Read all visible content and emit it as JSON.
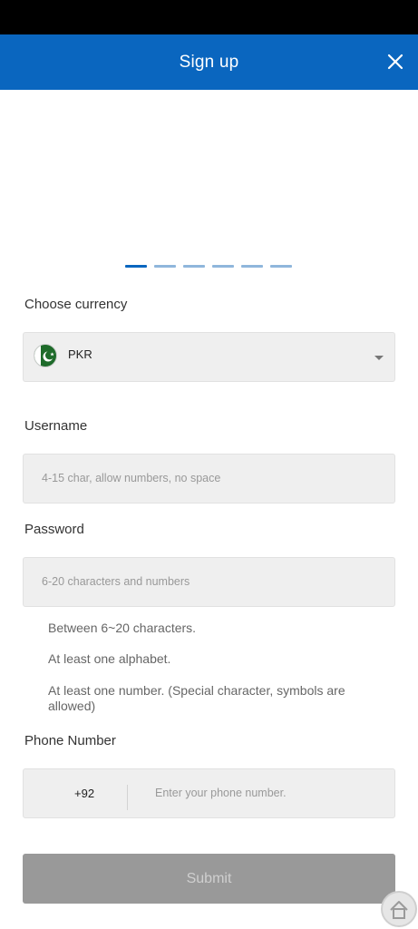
{
  "header": {
    "title": "Sign up",
    "close_icon": "close-icon"
  },
  "carousel": {
    "dot_count": 6,
    "active_index": 0
  },
  "currency": {
    "label": "Choose currency",
    "selected": "PKR",
    "flag_icon": "pakistan-flag-icon"
  },
  "username": {
    "label": "Username",
    "placeholder": "4-15 char, allow numbers, no space"
  },
  "password": {
    "label": "Password",
    "placeholder": "6-20 characters and numbers",
    "rules": [
      "Between 6~20 characters.",
      "At least one alphabet.",
      "At least one number. (Special character, symbols are allowed)"
    ]
  },
  "phone": {
    "label": "Phone Number",
    "code": "+92",
    "placeholder": "Enter your phone number."
  },
  "submit": {
    "label": "Submit"
  },
  "colors": {
    "header_blue": "#0a66bf",
    "field_bg": "#efefef",
    "submit_disabled": "#999999"
  }
}
